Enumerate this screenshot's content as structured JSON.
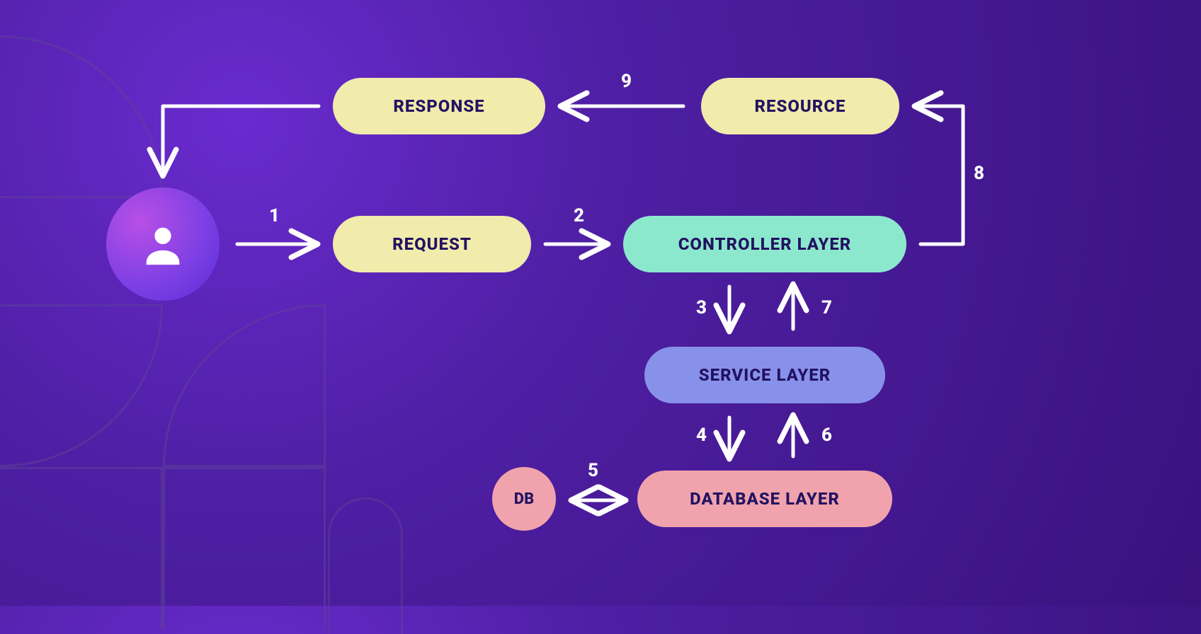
{
  "nodes": {
    "response": "RESPONSE",
    "resource": "RESOURCE",
    "request": "REQUEST",
    "controller": "CONTROLLER LAYER",
    "service": "SERVICE LAYER",
    "database": "DATABASE LAYER",
    "db": "DB"
  },
  "steps": {
    "s1": "1",
    "s2": "2",
    "s3": "3",
    "s4": "4",
    "s5": "5",
    "s6": "6",
    "s7": "7",
    "s8": "8",
    "s9": "9"
  },
  "colors": {
    "yellow": "#F1EBAC",
    "mint": "#8CE8CD",
    "blue": "#8891EA",
    "pink": "#F0A3AC",
    "text": "#231261",
    "bg": "#3B117E",
    "arrow": "#FFFFFF"
  }
}
